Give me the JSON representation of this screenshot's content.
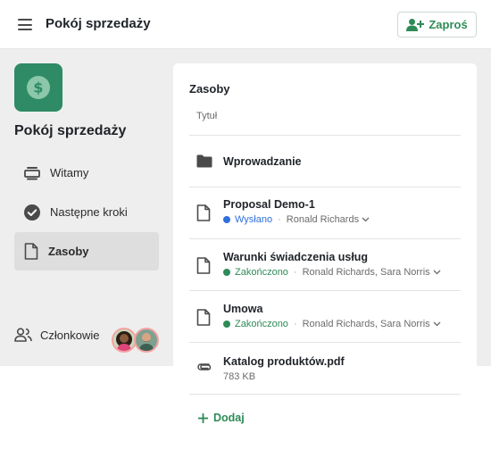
{
  "header": {
    "title": "Pokój sprzedaży",
    "invite_label": "Zaproś"
  },
  "sidebar": {
    "room_name": "Pokój sprzedaży",
    "items": [
      {
        "label": "Witamy",
        "icon": "welcome-icon",
        "active": false
      },
      {
        "label": "Następne kroki",
        "icon": "check-circle-icon",
        "active": false
      },
      {
        "label": "Zasoby",
        "icon": "document-icon",
        "active": true
      }
    ],
    "members_label": "Członkowie"
  },
  "main": {
    "section_title": "Zasoby",
    "column_header": "Tytuł",
    "rows": [
      {
        "title": "Wprowadzanie",
        "icon": "folder-icon"
      },
      {
        "title": "Proposal Demo-1",
        "icon": "document-icon",
        "status": "Wysłano",
        "people": "Ronald Richards"
      },
      {
        "title": "Warunki świadczenia usług",
        "icon": "document-icon",
        "status": "Zakończono",
        "people": "Ronald Richards, Sara Norris"
      },
      {
        "title": "Umowa",
        "icon": "document-icon",
        "status": "Zakończono",
        "people": "Ronald Richards, Sara Norris"
      },
      {
        "title": "Katalog produktów.pdf",
        "icon": "paperclip-icon",
        "size": "783 KB"
      }
    ],
    "add_label": "Dodaj"
  },
  "colors": {
    "accent": "#2e8b57",
    "logo_bg": "#2e8b65",
    "sent": "#2f6fde",
    "completed": "#2e8b57",
    "background": "#eeeeee"
  }
}
